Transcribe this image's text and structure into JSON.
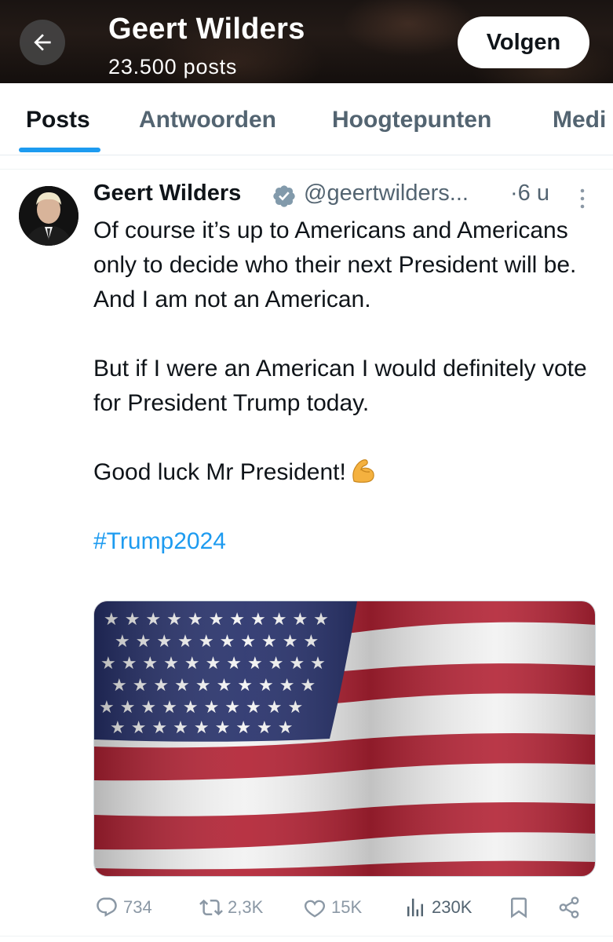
{
  "header": {
    "back_icon": "arrow-left-icon",
    "name": "Geert Wilders",
    "post_count": "23.500 posts",
    "follow_label": "Volgen"
  },
  "tabs": [
    {
      "label": "Posts",
      "active": true
    },
    {
      "label": "Antwoorden",
      "active": false
    },
    {
      "label": "Hoogtepunten",
      "active": false
    },
    {
      "label": "Medi",
      "active": false
    }
  ],
  "post": {
    "author": "Geert Wilders",
    "verified_icon": "verified-badge-icon",
    "handle": "@geertwilders...",
    "time": "·6 u",
    "more_icon": "more-vertical-icon",
    "lines": {
      "p1": "Of course it’s up to Americans and Americans only to decide who their next President will be. And I am not an American.",
      "p2": "But if I were an American I would definitely vote for President Trump today.",
      "p3": "Good luck Mr President!",
      "emoji": "flexed-biceps-icon",
      "hashtag": "#Trump2024"
    },
    "media": "american-flag-image"
  },
  "actions": {
    "replies": "734",
    "reposts": "2,3K",
    "likes": "15K",
    "views": "230K"
  },
  "colors": {
    "accent": "#1d9bf0",
    "secondary_text": "#536471",
    "flag_red": "#b22234",
    "flag_blue": "#26306a"
  }
}
